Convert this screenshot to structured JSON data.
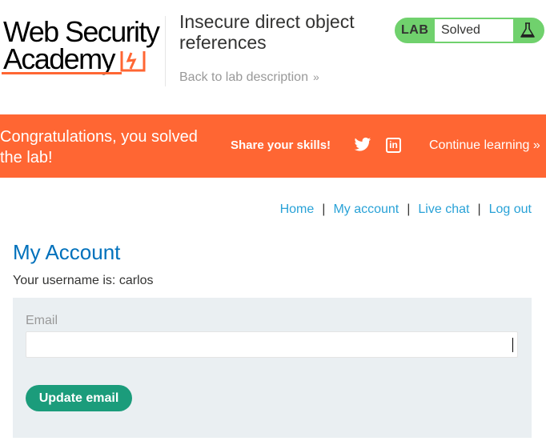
{
  "header": {
    "logo_line1": "Web Security",
    "logo_line2": "Academy",
    "lab_title": "Insecure direct object references",
    "back_link": "Back to lab description",
    "back_chevron": "»",
    "lab_badge": {
      "label": "LAB",
      "state": "Solved",
      "icon": "flask-icon"
    }
  },
  "banner": {
    "message": "Congratulations, you solved the lab!",
    "share": "Share your skills!",
    "twitter_icon": "twitter-icon",
    "linkedin_text": "in",
    "continue": "Continue learning",
    "continue_chevron": "»"
  },
  "nav": {
    "items": [
      "Home",
      "My account",
      "Live chat",
      "Log out"
    ],
    "separator": "|"
  },
  "main": {
    "title": "My Account",
    "username_text": "Your username is: carlos",
    "email_label": "Email",
    "email_value": "",
    "update_button": "Update email"
  },
  "colors": {
    "brand_orange": "#ff6633",
    "lab_green": "#70d16d",
    "link_blue": "#29a2d7",
    "title_blue": "#0071bc",
    "button_green": "#1b9c7b",
    "panel_bg": "#eaeff2"
  }
}
